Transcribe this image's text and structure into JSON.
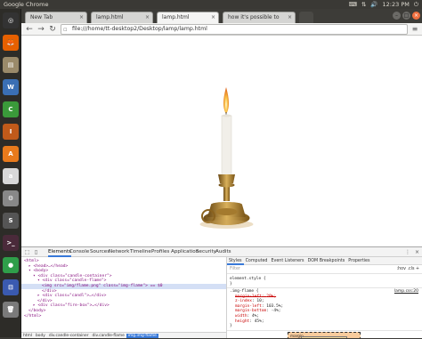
{
  "system": {
    "app_name": "Google Chrome",
    "clock": "12:23 PM",
    "launcher": [
      {
        "name": "dash-home-icon",
        "glyph": "◎",
        "color": "#333333"
      },
      {
        "name": "firefox-icon",
        "glyph": "🦊",
        "color": "#e66000"
      },
      {
        "name": "files-icon",
        "glyph": "▤",
        "color": "#9a8a6a"
      },
      {
        "name": "writer-icon",
        "glyph": "W",
        "color": "#3a6fb4"
      },
      {
        "name": "calc-icon",
        "glyph": "C",
        "color": "#3a9a3a"
      },
      {
        "name": "impress-icon",
        "glyph": "I",
        "color": "#c05a1a"
      },
      {
        "name": "software-center-icon",
        "glyph": "A",
        "color": "#e87a1c"
      },
      {
        "name": "amazon-icon",
        "glyph": "a",
        "color": "#d8d8d8"
      },
      {
        "name": "settings-icon",
        "glyph": "⚙",
        "color": "#888888"
      },
      {
        "name": "sublime-icon",
        "glyph": "S",
        "color": "#555555"
      },
      {
        "name": "terminal-icon",
        "glyph": ">_",
        "color": "#4a2a3a"
      },
      {
        "name": "chrome-icon",
        "glyph": "●",
        "color": "#2f9e4a"
      },
      {
        "name": "app-icon",
        "glyph": "⊟",
        "color": "#3a5ab0"
      },
      {
        "name": "trash-icon",
        "glyph": "🗑",
        "color": "#7a7a7a"
      }
    ]
  },
  "browser": {
    "tabs": [
      {
        "label": "New Tab",
        "active": false
      },
      {
        "label": "lamp.html",
        "active": false
      },
      {
        "label": "lamp.html",
        "active": true
      },
      {
        "label": "how it's possible to",
        "active": false
      }
    ],
    "url": "file:///home/tt-desktop2/Desktop/lamp/lamp.html"
  },
  "devtools": {
    "tabs": [
      "Elements",
      "Console",
      "Sources",
      "Network",
      "Timeline",
      "Profiles",
      "Application",
      "Security",
      "Audits"
    ],
    "active_tab": "Elements",
    "dom_lines": [
      {
        "indent": 0,
        "text": "<html>"
      },
      {
        "indent": 1,
        "text": "▸ <head>…</head>"
      },
      {
        "indent": 1,
        "text": "▾ <body>"
      },
      {
        "indent": 2,
        "text": "▾ <div class=\"candle-container\">"
      },
      {
        "indent": 3,
        "text": "▾ <div class=\"candle-flame\">"
      },
      {
        "indent": 4,
        "text": "<img src=\"img/flame.png\" class=\"img-flame\"> == $0",
        "selected": true
      },
      {
        "indent": 4,
        "text": "</div>"
      },
      {
        "indent": 3,
        "text": "▸ <div class=\"candl\">…</div>"
      },
      {
        "indent": 3,
        "text": "</div>"
      },
      {
        "indent": 2,
        "text": "▸ <div class=\"fire-box\">…</div>"
      },
      {
        "indent": 1,
        "text": "</body>"
      },
      {
        "indent": 0,
        "text": "</html>"
      }
    ],
    "breadcrumbs": [
      "html",
      "body",
      "div.candle-container",
      "div.candle-flame",
      "img.img-flame"
    ],
    "styles_tabs": [
      "Styles",
      "Computed",
      "Event Listeners",
      "DOM Breakpoints",
      "Properties"
    ],
    "filter_placeholder": "Filter",
    "filter_opts": ":hov  .cls  +",
    "element_style": "element.style {",
    "element_style_close": "}",
    "rule_selector": ".img-flame {",
    "rule_source": "lamp.css:20",
    "rule_props": [
      {
        "name": "margin-left",
        "value": "20%",
        "struck": true
      },
      {
        "name": "z-index",
        "value": "10",
        "struck": false
      },
      {
        "name": "margin-left",
        "value": "103.5%",
        "struck": false
      },
      {
        "name": "margin-bottom",
        "value": "-4%",
        "struck": false
      },
      {
        "name": "width",
        "value": "4%",
        "struck": false
      },
      {
        "name": "height",
        "value": "45%",
        "struck": false
      }
    ],
    "rule_close": "}",
    "box_label": "margin"
  },
  "colors": {
    "accent": "#3879d9",
    "candle": "#f1efe9",
    "brass": "#b88a3a",
    "flame": "#f5a623"
  }
}
